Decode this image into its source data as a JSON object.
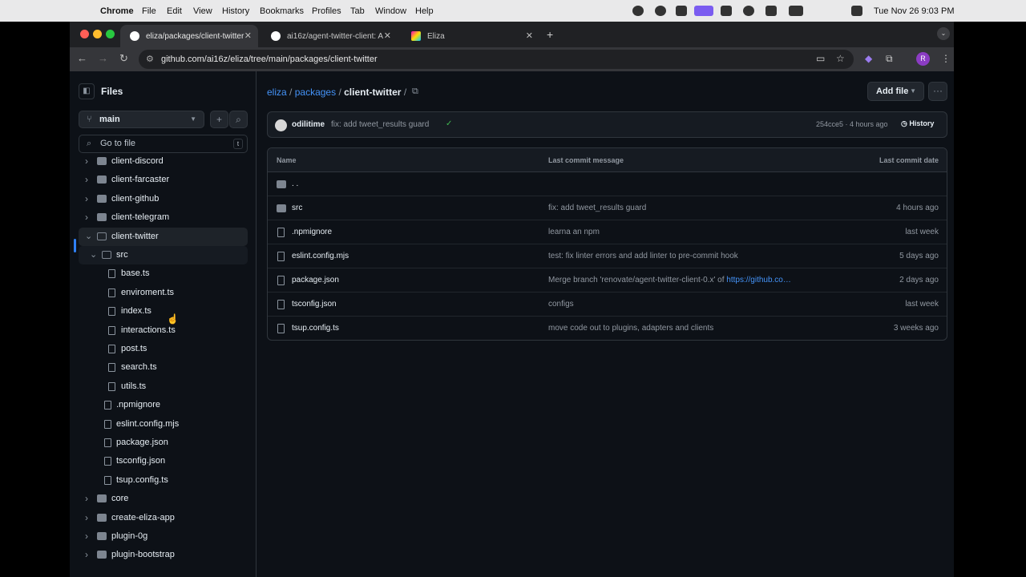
{
  "menubar": {
    "app": "Chrome",
    "items": [
      "File",
      "Edit",
      "View",
      "History",
      "Bookmarks",
      "Profiles",
      "Tab",
      "Window",
      "Help"
    ],
    "datetime": "Tue Nov 26  9:03 PM"
  },
  "tabs": [
    {
      "title": "eliza/packages/client-twitter",
      "active": true
    },
    {
      "title": "ai16z/agent-twitter-client: A",
      "active": false
    },
    {
      "title": "Eliza",
      "active": false
    }
  ],
  "url": "github.com/ai16z/eliza/tree/main/packages/client-twitter",
  "avatar_letter": "R",
  "sidebar": {
    "title": "Files",
    "branch": "main",
    "goto_placeholder": "Go to file",
    "goto_shortcut": "t",
    "tree": [
      {
        "label": "client-discord",
        "type": "folder",
        "depth": 0,
        "expanded": false
      },
      {
        "label": "client-farcaster",
        "type": "folder",
        "depth": 0,
        "expanded": false
      },
      {
        "label": "client-github",
        "type": "folder",
        "depth": 0,
        "expanded": false
      },
      {
        "label": "client-telegram",
        "type": "folder",
        "depth": 0,
        "expanded": false
      },
      {
        "label": "client-twitter",
        "type": "folder",
        "depth": 0,
        "expanded": true,
        "selected": true
      },
      {
        "label": "src",
        "type": "folder",
        "depth": 1,
        "expanded": true,
        "hover": true
      },
      {
        "label": "base.ts",
        "type": "file",
        "depth": 2
      },
      {
        "label": "enviroment.ts",
        "type": "file",
        "depth": 2
      },
      {
        "label": "index.ts",
        "type": "file",
        "depth": 2
      },
      {
        "label": "interactions.ts",
        "type": "file",
        "depth": 2
      },
      {
        "label": "post.ts",
        "type": "file",
        "depth": 2
      },
      {
        "label": "search.ts",
        "type": "file",
        "depth": 2
      },
      {
        "label": "utils.ts",
        "type": "file",
        "depth": 2
      },
      {
        "label": ".npmignore",
        "type": "file",
        "depth": 1
      },
      {
        "label": "eslint.config.mjs",
        "type": "file",
        "depth": 1
      },
      {
        "label": "package.json",
        "type": "file",
        "depth": 1
      },
      {
        "label": "tsconfig.json",
        "type": "file",
        "depth": 1
      },
      {
        "label": "tsup.config.ts",
        "type": "file",
        "depth": 1
      },
      {
        "label": "core",
        "type": "folder",
        "depth": 0,
        "expanded": false
      },
      {
        "label": "create-eliza-app",
        "type": "folder",
        "depth": 0,
        "expanded": false
      },
      {
        "label": "plugin-0g",
        "type": "folder",
        "depth": 0,
        "expanded": false
      },
      {
        "label": "plugin-bootstrap",
        "type": "folder",
        "depth": 0,
        "expanded": false
      }
    ]
  },
  "main": {
    "breadcrumb": {
      "repo": "eliza",
      "sep1": "/",
      "folder": "packages",
      "sep2": "/",
      "current": "client-twitter",
      "sep3": "/"
    },
    "add_file": "Add file",
    "more": "···",
    "commit": {
      "author": "odilitime",
      "message": "fix: add tweet_results guard",
      "check": "✓",
      "sha_time": "254cce5 · 4 hours ago",
      "history": "History"
    },
    "table": {
      "headers": {
        "name": "Name",
        "message": "Last commit message",
        "date": "Last commit date"
      },
      "rows": [
        {
          "name": ". .",
          "type": "folder",
          "message": "",
          "date": ""
        },
        {
          "name": "src",
          "type": "folder",
          "message": "fix: add tweet_results guard",
          "date": "4 hours ago"
        },
        {
          "name": ".npmignore",
          "type": "file",
          "message": "learna an npm",
          "date": "last week"
        },
        {
          "name": "eslint.config.mjs",
          "type": "file",
          "message": "test: fix linter errors and add linter to pre-commit hook",
          "date": "5 days ago"
        },
        {
          "name": "package.json",
          "type": "file",
          "message": "Merge branch 'renovate/agent-twitter-client-0.x' of ",
          "link": "https://github.co…",
          "date": "2 days ago"
        },
        {
          "name": "tsconfig.json",
          "type": "file",
          "message": "configs",
          "date": "last week"
        },
        {
          "name": "tsup.config.ts",
          "type": "file",
          "message": "move code out to plugins, adapters and clients",
          "date": "3 weeks ago"
        }
      ]
    }
  }
}
